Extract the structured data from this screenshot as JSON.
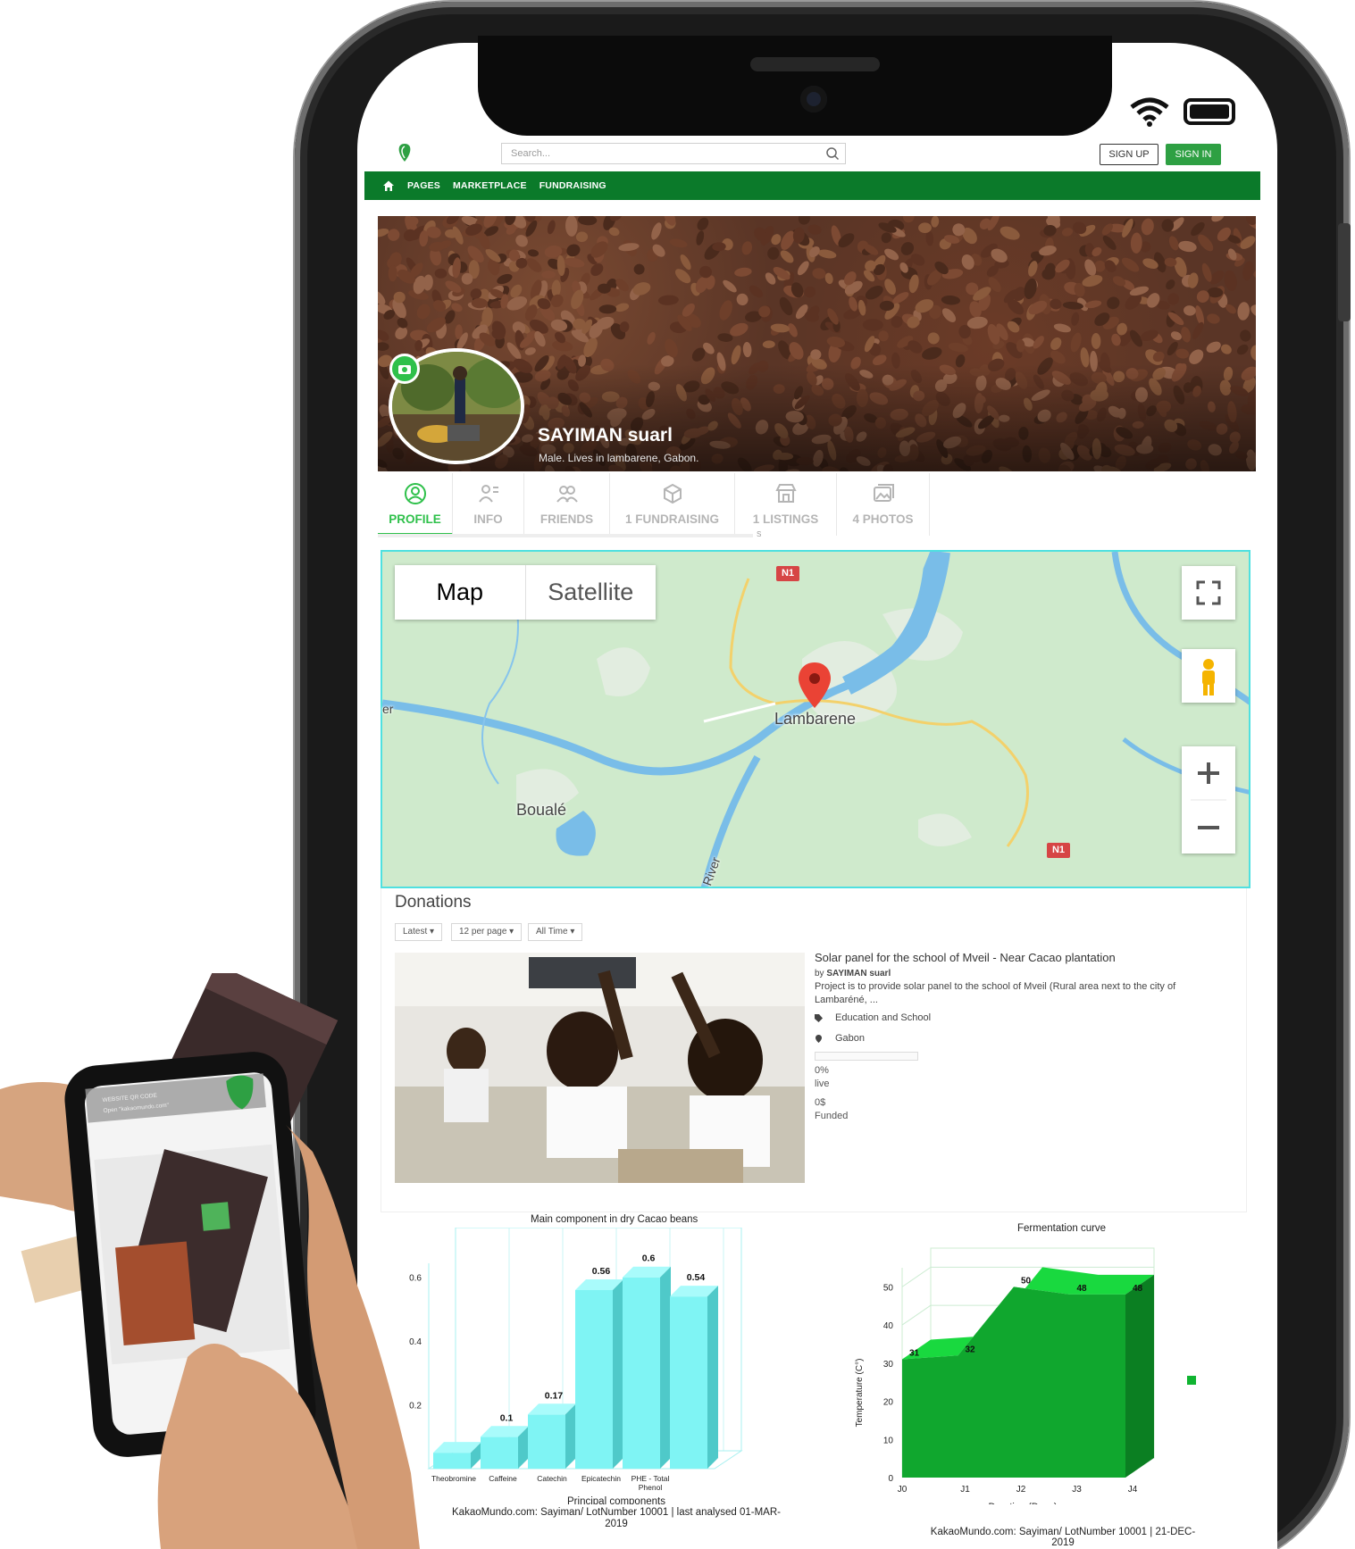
{
  "site": {
    "search_placeholder": "Search...",
    "signup_label": "SIGN UP",
    "signin_label": "SIGN IN",
    "nav": [
      "PAGES",
      "MARKETPLACE",
      "FUNDRAISING"
    ]
  },
  "profile": {
    "name": "SAYIMAN suarl",
    "subtitle": "Male. Lives in lambarene,  Gabon.",
    "tabs": [
      {
        "label": "PROFILE",
        "icon": "user-icon",
        "active": true
      },
      {
        "label": "INFO",
        "icon": "info-icon",
        "active": false
      },
      {
        "label": "FRIENDS",
        "icon": "friends-icon",
        "active": false
      },
      {
        "label": "1 FUNDRAISING",
        "icon": "box-icon",
        "active": false
      },
      {
        "label": "1 LISTINGS",
        "icon": "store-icon",
        "active": false
      },
      {
        "label": "4 PHOTOS",
        "icon": "photos-icon",
        "active": false
      }
    ],
    "tab_overflow": "S"
  },
  "map": {
    "type_map": "Map",
    "type_satellite": "Satellite",
    "labels": {
      "city": "Lambarene",
      "town": "Boualé",
      "river1": "River",
      "river2": "er"
    },
    "road_shield": "N1"
  },
  "donations": {
    "title": "Donations",
    "filters": [
      "Latest",
      "12 per page",
      "All Time"
    ],
    "item": {
      "title": "Solar panel for the school of Mveil - Near Cacao plantation",
      "by_prefix": "by",
      "by_name": "SAYIMAN suarl",
      "description": "Project is to provide solar panel to the school of Mveil (Rural area next to the city of Lambaréné, ...",
      "category": "Education and School",
      "location": "Gabon",
      "progress": 0,
      "percent_text": "0%",
      "status_text": "live",
      "amount_text": "0$",
      "funded_text": "Funded"
    }
  },
  "chart_data": [
    {
      "type": "bar",
      "title": "Main component in dry Cacao beans",
      "categories": [
        "Theobromine",
        "Caffeine",
        "Catechin",
        "Epicatechin",
        "PHE - Total Phenol"
      ],
      "values": [
        0.05,
        0.1,
        0.17,
        0.56,
        0.6,
        0.54
      ],
      "bar_labels": [
        "",
        "0.1",
        "0.17",
        "0.56",
        "0.6",
        "0.54"
      ],
      "xlabel": "Principal components",
      "yticks": [
        "0.2",
        "0.4",
        "0.6"
      ],
      "ylim": [
        0,
        0.7
      ],
      "footer": "KakaoMundo.com: Sayiman/ LotNumber 10001 | last analysed 01-MAR-2019",
      "color": "#7df5f5"
    },
    {
      "type": "area",
      "title": "Fermentation curve",
      "x": [
        "J0",
        "J1",
        "J2",
        "J3",
        "J4"
      ],
      "y": [
        31,
        32,
        50,
        48,
        48
      ],
      "xlabel": "Duration (Days)",
      "ylabel": "Temperature (C°)",
      "yticks": [
        "0",
        "10",
        "20",
        "30",
        "40",
        "50"
      ],
      "ylim": [
        0,
        55
      ],
      "footer": "KakaoMundo.com: Sayiman/ LotNumber 10001 | 21-DEC-2019",
      "color": "#10b431"
    }
  ],
  "scanner_phone": {
    "header_line1": "WEBSITE QR CODE",
    "header_line2": "Open \"kakaomundo.com\""
  }
}
